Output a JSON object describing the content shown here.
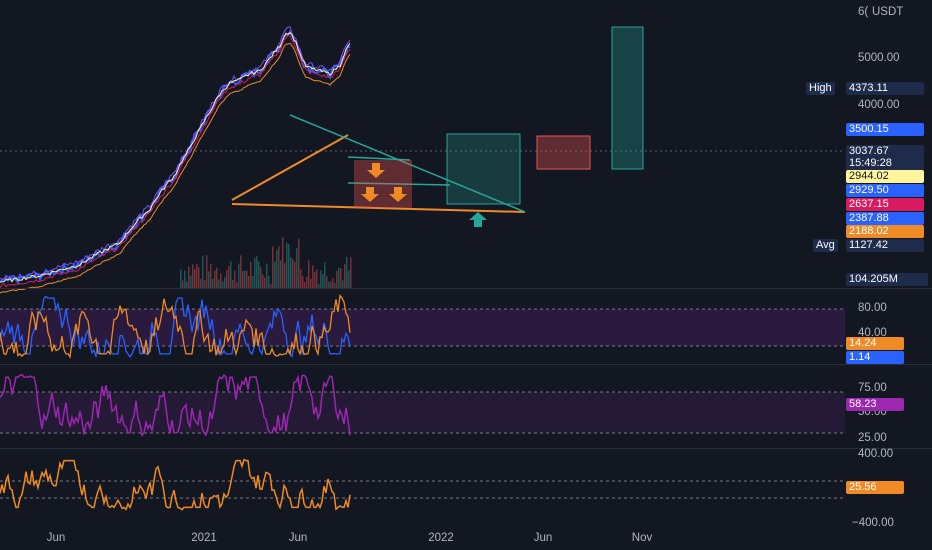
{
  "currency": "USDT",
  "price_axis_clip": "6(",
  "colors": {
    "bg": "#131722",
    "teal": "#26a69a",
    "orange": "#f08a24",
    "purple": "#9c27b0",
    "blue": "#2962ff",
    "yellow": "#ffeb3b",
    "pink": "#d81b60"
  },
  "main": {
    "price_ticks": [
      "5000.00",
      "4000.00"
    ],
    "labels": {
      "high_title": "High",
      "high_value": "4373.11",
      "p3500": "3500.15",
      "last_price": "3037.67",
      "countdown": "15:49:28",
      "p2944": "2944.02",
      "p2929": "2929.50",
      "p2637": "2637.15",
      "p2387": "2387.88",
      "p2188": "2188.02",
      "avg_title": "Avg",
      "avg_value": "1127.42",
      "volume": "104.205M"
    }
  },
  "stoch": {
    "ticks": [
      "80.00",
      "40.00"
    ],
    "k_label": "14.24",
    "d_label": "1.14"
  },
  "rsi": {
    "ticks": [
      "75.00",
      "50.00",
      "25.00"
    ],
    "value_label": "58.23"
  },
  "cci": {
    "ticks": [
      "400.00",
      "−400.00"
    ],
    "value_label": "25.56"
  },
  "x_labels": [
    "Jun",
    "2021",
    "Jun",
    "2022",
    "Jun",
    "Nov"
  ],
  "chart_data": {
    "type": "line",
    "title": "",
    "series": [
      {
        "approx_price_path": [
          [
            0,
            100
          ],
          [
            40,
            110
          ],
          [
            80,
            130
          ],
          [
            120,
            180
          ],
          [
            150,
            300
          ],
          [
            175,
            500
          ],
          [
            190,
            750
          ],
          [
            200,
            1000
          ],
          [
            210,
            1300
          ],
          [
            220,
            1700
          ],
          [
            230,
            2000
          ],
          [
            240,
            2100
          ],
          [
            250,
            2300
          ],
          [
            260,
            2400
          ],
          [
            270,
            2900
          ],
          [
            280,
            3500
          ],
          [
            285,
            4200
          ],
          [
            290,
            4300
          ],
          [
            295,
            3800
          ],
          [
            300,
            3100
          ],
          [
            305,
            2600
          ],
          [
            310,
            2500
          ],
          [
            320,
            2400
          ],
          [
            330,
            2300
          ],
          [
            340,
            2600
          ],
          [
            345,
            3200
          ],
          [
            350,
            3600
          ]
        ]
      }
    ],
    "price_axis_labels": [
      5000,
      4000
    ],
    "annotated_levels": [
      4373.11,
      3500.15,
      3037.67,
      2944.02,
      2929.5,
      2637.15,
      2387.88,
      2188.02,
      1127.42
    ],
    "stoch_levels": [
      80,
      40
    ],
    "rsi_levels": [
      75,
      50,
      25
    ],
    "cci_levels": [
      400,
      -400
    ],
    "x_axis": [
      "Jun",
      "2021",
      "Jun",
      "2022",
      "Jun",
      "Nov"
    ]
  }
}
